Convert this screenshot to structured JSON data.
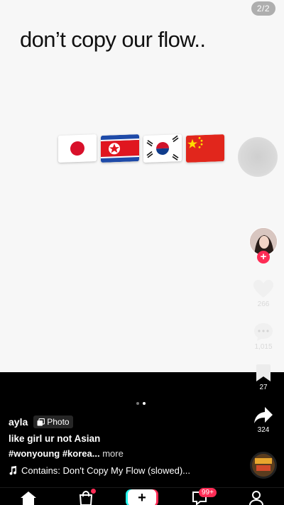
{
  "post": {
    "page_counter": "2/2",
    "headline": "don’t copy our flow..",
    "flags": [
      "flag-japan-icon",
      "flag-north-korea-icon",
      "flag-south-korea-icon",
      "flag-china-icon"
    ],
    "carousel": {
      "total_pages": 2,
      "current_page": 2
    }
  },
  "rail": {
    "likes": "266",
    "comments": "1,015",
    "saves": "27",
    "shares": "324"
  },
  "info": {
    "username": "ayla",
    "type_label": "Photo",
    "caption": "like girl ur not Asian",
    "hashtags": "#wonyoung #korea...",
    "more_label": "more",
    "music": "Contains: Don't Copy My Flow (slowed)..."
  },
  "nav": {
    "inbox_badge": "99+"
  },
  "colors": {
    "accent": "#fe2c55",
    "teal": "#25f4ee"
  }
}
